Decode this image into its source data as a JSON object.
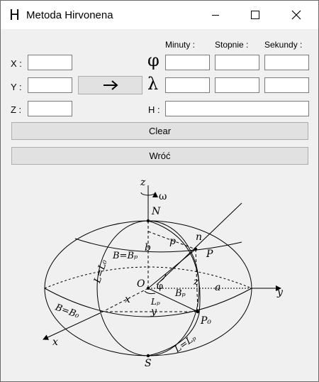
{
  "window": {
    "title": "Metoda Hirvonena",
    "icon_glyph": "H",
    "icon_name": "app-h-icon"
  },
  "labels": {
    "x": "X :",
    "y": "Y :",
    "z": "Z :",
    "h": "H :",
    "minuty": "Minuty :",
    "stopnie": "Stopnie :",
    "sekundy": "Sekundy :",
    "phi": "φ",
    "lambda": "λ"
  },
  "inputs": {
    "x": "",
    "y": "",
    "z": "",
    "phi_min": "",
    "phi_deg": "",
    "phi_sec": "",
    "lam_min": "",
    "lam_deg": "",
    "lam_sec": "",
    "h": ""
  },
  "buttons": {
    "convert_icon": "arrow-right-icon",
    "clear": "Clear",
    "back": "Wróć"
  },
  "diagram": {
    "z": "z",
    "omega": "ω",
    "N": "N",
    "b": "b",
    "p": "p",
    "n": "n",
    "P": "P",
    "B_eq_Bp": "B=Bₚ",
    "L_eq_L0": "L=L₀",
    "O": "O",
    "phi": "φ",
    "Bp": "Bₚ",
    "zlabel": "z",
    "a": "a",
    "y": "y",
    "x_in": "x",
    "Lp": "Lₚ",
    "y_in": "y",
    "B_eq_B0": "B=B₀",
    "P0": "P₀",
    "L_eq_Lp": "L=Lₚ",
    "x": "x",
    "S": "S"
  }
}
